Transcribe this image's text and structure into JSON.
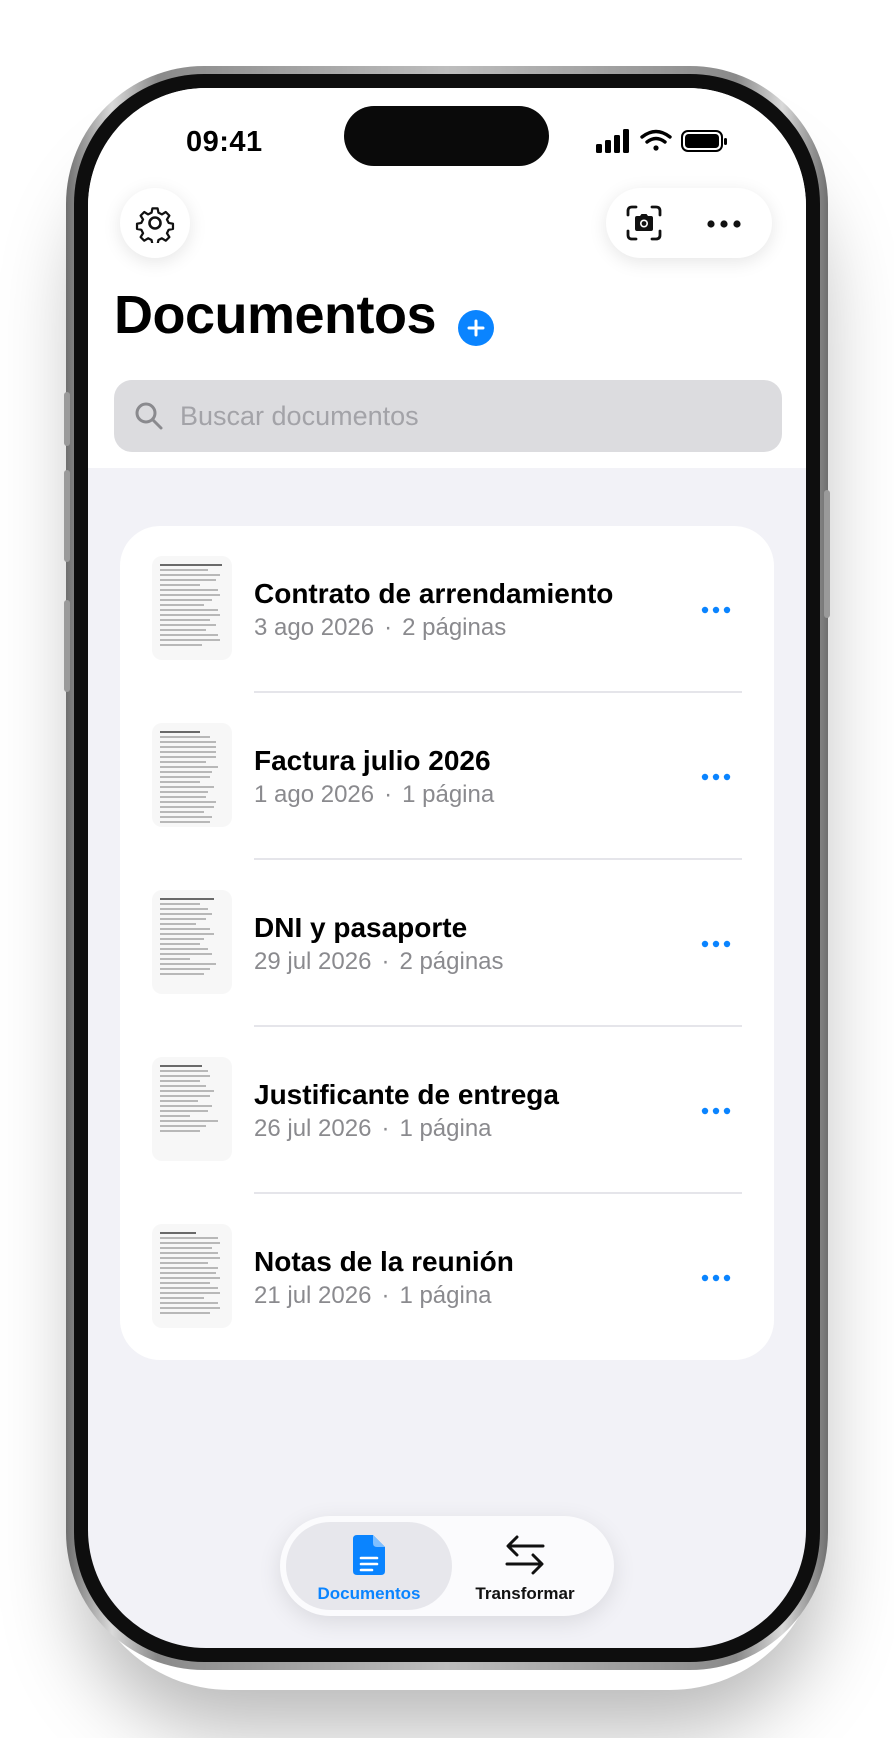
{
  "status_bar": {
    "time": "09:41"
  },
  "header": {
    "title": "Documentos"
  },
  "search": {
    "placeholder": "Buscar documentos",
    "value": ""
  },
  "documents": [
    {
      "name": "Contrato de arrendamiento",
      "date": "3 ago 2026",
      "pages": "2 páginas"
    },
    {
      "name": "Factura julio 2026",
      "date": "1 ago 2026",
      "pages": "1 página"
    },
    {
      "name": "DNI y pasaporte",
      "date": "29 jul 2026",
      "pages": "2 páginas"
    },
    {
      "name": "Justificante de entrega",
      "date": "26 jul 2026",
      "pages": "1 página"
    },
    {
      "name": "Notas de la reunión",
      "date": "21 jul 2026",
      "pages": "1 página"
    }
  ],
  "meta_separator": "·",
  "tabbar": {
    "tabs": [
      {
        "label": "Documentos",
        "active": true
      },
      {
        "label": "Transformar",
        "active": false
      }
    ]
  },
  "colors": {
    "accent": "#0a84ff",
    "background": "#f2f2f7",
    "secondary_text": "#8a8a8e"
  }
}
